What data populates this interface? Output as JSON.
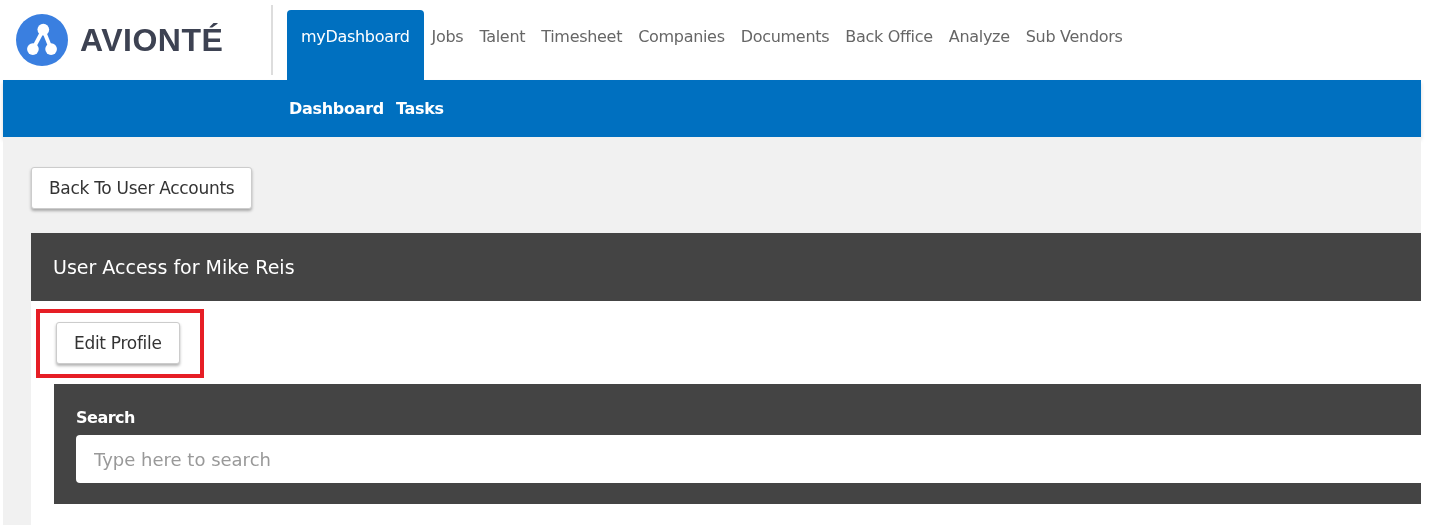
{
  "logo": {
    "text": "AVIONTÉ"
  },
  "tabs": [
    {
      "label": "myDashboard",
      "selected": true
    },
    {
      "label": "Jobs",
      "selected": false
    },
    {
      "label": "Talent",
      "selected": false
    },
    {
      "label": "Timesheet",
      "selected": false
    },
    {
      "label": "Companies",
      "selected": false
    },
    {
      "label": "Documents",
      "selected": false
    },
    {
      "label": "Back Office",
      "selected": false
    },
    {
      "label": "Analyze",
      "selected": false
    },
    {
      "label": "Sub Vendors",
      "selected": false
    }
  ],
  "subnav": [
    "Dashboard",
    "Tasks"
  ],
  "back_button": "Back To User Accounts",
  "panel": {
    "title": "User Access for Mike Reis",
    "edit_button": {
      "label": "Edit Profile",
      "highlighted": true
    },
    "search": {
      "label": "Search",
      "placeholder": "Type here to search"
    }
  }
}
